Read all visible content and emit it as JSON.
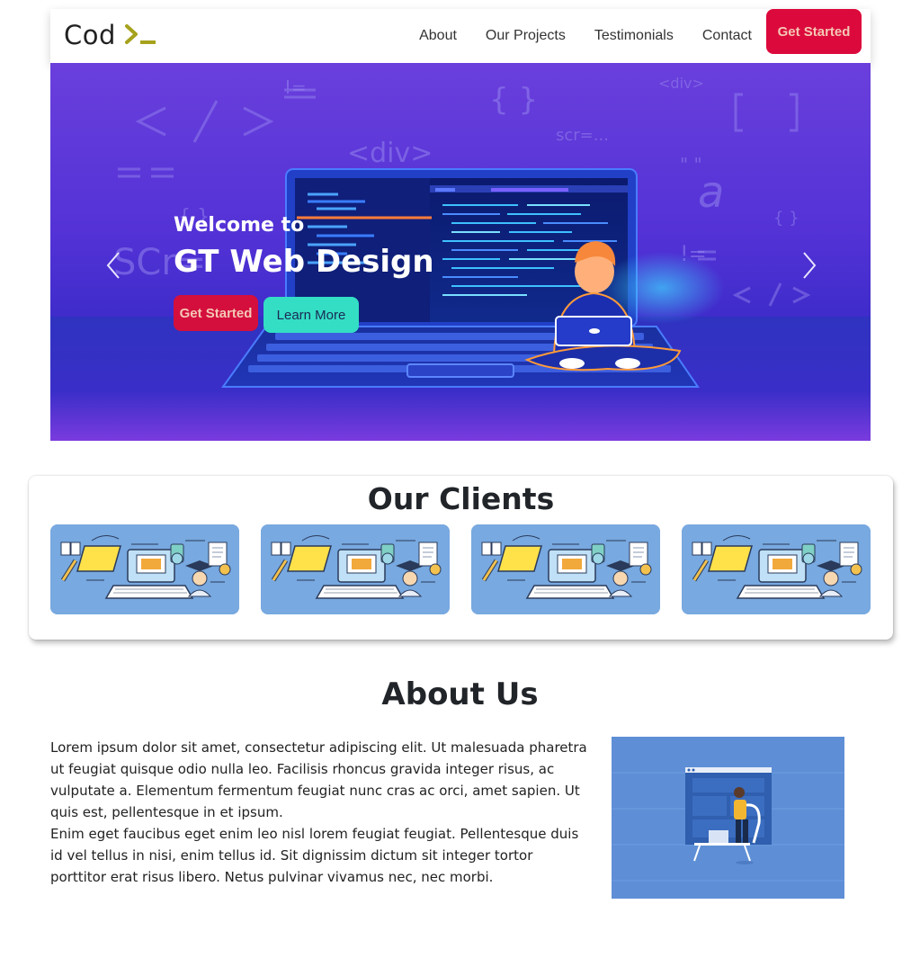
{
  "navbar": {
    "brand": "Cod",
    "brand_icon": "terminal-prompt-icon",
    "links": [
      "About",
      "Our Projects",
      "Testimonials",
      "Contact"
    ],
    "cta": "Get Started"
  },
  "hero": {
    "welcome": "Welcome to",
    "title": "GT Web Design",
    "primary_button": "Get Started",
    "secondary_button": "Learn More",
    "prev_icon": "chevron-left-icon",
    "next_icon": "chevron-right-icon"
  },
  "clients": {
    "title": "Our Clients",
    "cards": [
      {
        "image": "education-illustration"
      },
      {
        "image": "education-illustration"
      },
      {
        "image": "education-illustration"
      },
      {
        "image": "education-illustration"
      }
    ]
  },
  "about": {
    "title": "About Us",
    "paragraph1": "Lorem ipsum dolor sit amet, consectetur adipiscing elit. Ut malesuada pharetra ut feugiat quisque odio nulla leo. Facilisis rhoncus gravida integer risus, ac vulputate a. Elementum fermentum feugiat nunc cras ac orci, amet sapien. Ut quis est, pellentesque in et ipsum.",
    "paragraph2": "Enim eget faucibus eget enim leo nisl lorem feugiat feugiat. Pellentesque duis id vel tellus in nisi, enim tellus id. Sit dignissim dictum sit integer tortor porttitor erat risus libero. Netus pulvinar vivamus nec, nec morbi.",
    "image": "developer-at-desk-illustration"
  },
  "colors": {
    "accent_red": "#dc0a3c",
    "accent_teal": "#34dec4",
    "hero_purple": "#5332d6",
    "brand_olive": "#a6a21c"
  }
}
